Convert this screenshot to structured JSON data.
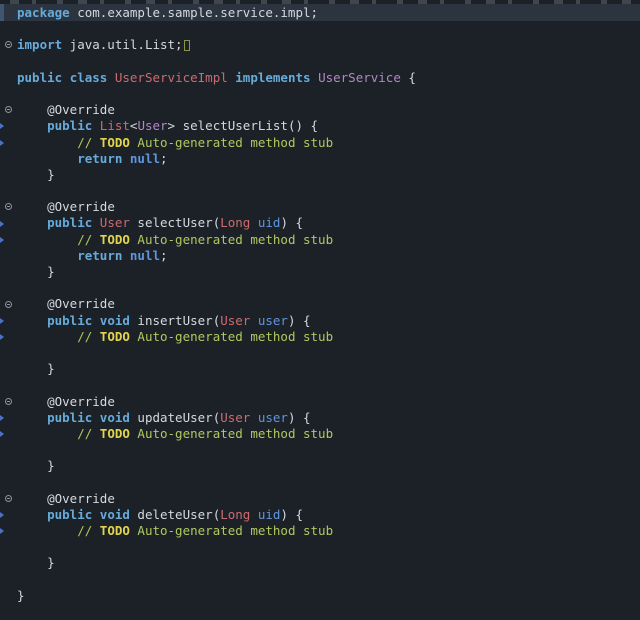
{
  "editor": {
    "background": "#1c2128",
    "current_line_bg": "#2c3440",
    "current_line_bar": "#3e566f",
    "colors": {
      "keyword": "#66abd9",
      "plain": "#d4d9de",
      "class_type": "#cc6b6f",
      "interface_type": "#b288c6",
      "comment": "#aec95e",
      "task_tag": "#e0d54e",
      "param_value": "#5f95dd"
    },
    "gutter": {
      "fold_icon_lines": [
        3,
        7,
        13,
        19,
        25,
        31
      ],
      "edge_marker_lines": [
        8,
        9,
        14,
        15,
        20,
        21,
        26,
        27,
        32,
        33
      ]
    },
    "code": {
      "lines": [
        {
          "n": 1,
          "highlight": true,
          "tokens": [
            {
              "c": "kw",
              "t": "package"
            },
            {
              "c": "pl",
              "t": " com.example.sample.service.impl;"
            }
          ]
        },
        {
          "n": 2,
          "tokens": []
        },
        {
          "n": 3,
          "tokens": [
            {
              "c": "kw",
              "t": "import"
            },
            {
              "c": "pl",
              "t": " java.util.List;"
            },
            {
              "c": "box",
              "t": ""
            }
          ]
        },
        {
          "n": 4,
          "tokens": []
        },
        {
          "n": 5,
          "tokens": [
            {
              "c": "kw",
              "t": "public"
            },
            {
              "c": "pl",
              "t": " "
            },
            {
              "c": "kw",
              "t": "class"
            },
            {
              "c": "pl",
              "t": " "
            },
            {
              "c": "cls",
              "t": "UserServiceImpl"
            },
            {
              "c": "pl",
              "t": " "
            },
            {
              "c": "kw",
              "t": "implements"
            },
            {
              "c": "pl",
              "t": " "
            },
            {
              "c": "itf",
              "t": "UserService"
            },
            {
              "c": "pl",
              "t": " {"
            }
          ]
        },
        {
          "n": 6,
          "tokens": []
        },
        {
          "n": 7,
          "tokens": [
            {
              "c": "pl",
              "t": "    "
            },
            {
              "c": "ann",
              "t": "@Override"
            }
          ]
        },
        {
          "n": 8,
          "tokens": [
            {
              "c": "pl",
              "t": "    "
            },
            {
              "c": "kw",
              "t": "public"
            },
            {
              "c": "pl",
              "t": " "
            },
            {
              "c": "cls",
              "t": "List"
            },
            {
              "c": "pl",
              "t": "<"
            },
            {
              "c": "itf",
              "t": "User"
            },
            {
              "c": "pl",
              "t": "> selectUserList() {"
            }
          ]
        },
        {
          "n": 9,
          "tokens": [
            {
              "c": "cmt",
              "t": "        // "
            },
            {
              "c": "todo",
              "t": "TODO"
            },
            {
              "c": "cmt",
              "t": " Auto-generated method stub"
            }
          ]
        },
        {
          "n": 10,
          "tokens": [
            {
              "c": "pl",
              "t": "        "
            },
            {
              "c": "kw",
              "t": "return"
            },
            {
              "c": "pl",
              "t": " "
            },
            {
              "c": "nul",
              "t": "null"
            },
            {
              "c": "pl",
              "t": ";"
            }
          ]
        },
        {
          "n": 11,
          "tokens": [
            {
              "c": "pl",
              "t": "    }"
            }
          ]
        },
        {
          "n": 12,
          "tokens": []
        },
        {
          "n": 13,
          "tokens": [
            {
              "c": "pl",
              "t": "    "
            },
            {
              "c": "ann",
              "t": "@Override"
            }
          ]
        },
        {
          "n": 14,
          "tokens": [
            {
              "c": "pl",
              "t": "    "
            },
            {
              "c": "kw",
              "t": "public"
            },
            {
              "c": "pl",
              "t": " "
            },
            {
              "c": "cls",
              "t": "User"
            },
            {
              "c": "pl",
              "t": " selectUser("
            },
            {
              "c": "cls",
              "t": "Long"
            },
            {
              "c": "pl",
              "t": " "
            },
            {
              "c": "prm",
              "t": "uid"
            },
            {
              "c": "pl",
              "t": ") {"
            }
          ]
        },
        {
          "n": 15,
          "tokens": [
            {
              "c": "cmt",
              "t": "        // "
            },
            {
              "c": "todo",
              "t": "TODO"
            },
            {
              "c": "cmt",
              "t": " Auto-generated method stub"
            }
          ]
        },
        {
          "n": 16,
          "tokens": [
            {
              "c": "pl",
              "t": "        "
            },
            {
              "c": "kw",
              "t": "return"
            },
            {
              "c": "pl",
              "t": " "
            },
            {
              "c": "nul",
              "t": "null"
            },
            {
              "c": "pl",
              "t": ";"
            }
          ]
        },
        {
          "n": 17,
          "tokens": [
            {
              "c": "pl",
              "t": "    }"
            }
          ]
        },
        {
          "n": 18,
          "tokens": []
        },
        {
          "n": 19,
          "tokens": [
            {
              "c": "pl",
              "t": "    "
            },
            {
              "c": "ann",
              "t": "@Override"
            }
          ]
        },
        {
          "n": 20,
          "tokens": [
            {
              "c": "pl",
              "t": "    "
            },
            {
              "c": "kw",
              "t": "public"
            },
            {
              "c": "pl",
              "t": " "
            },
            {
              "c": "kw",
              "t": "void"
            },
            {
              "c": "pl",
              "t": " insertUser("
            },
            {
              "c": "cls",
              "t": "User"
            },
            {
              "c": "pl",
              "t": " "
            },
            {
              "c": "prm",
              "t": "user"
            },
            {
              "c": "pl",
              "t": ") {"
            }
          ]
        },
        {
          "n": 21,
          "tokens": [
            {
              "c": "cmt",
              "t": "        // "
            },
            {
              "c": "todo",
              "t": "TODO"
            },
            {
              "c": "cmt",
              "t": " Auto-generated method stub"
            }
          ]
        },
        {
          "n": 22,
          "tokens": []
        },
        {
          "n": 23,
          "tokens": [
            {
              "c": "pl",
              "t": "    }"
            }
          ]
        },
        {
          "n": 24,
          "tokens": []
        },
        {
          "n": 25,
          "tokens": [
            {
              "c": "pl",
              "t": "    "
            },
            {
              "c": "ann",
              "t": "@Override"
            }
          ]
        },
        {
          "n": 26,
          "tokens": [
            {
              "c": "pl",
              "t": "    "
            },
            {
              "c": "kw",
              "t": "public"
            },
            {
              "c": "pl",
              "t": " "
            },
            {
              "c": "kw",
              "t": "void"
            },
            {
              "c": "pl",
              "t": " updateUser("
            },
            {
              "c": "cls",
              "t": "User"
            },
            {
              "c": "pl",
              "t": " "
            },
            {
              "c": "prm",
              "t": "user"
            },
            {
              "c": "pl",
              "t": ") {"
            }
          ]
        },
        {
          "n": 27,
          "tokens": [
            {
              "c": "cmt",
              "t": "        // "
            },
            {
              "c": "todo",
              "t": "TODO"
            },
            {
              "c": "cmt",
              "t": " Auto-generated method stub"
            }
          ]
        },
        {
          "n": 28,
          "tokens": []
        },
        {
          "n": 29,
          "tokens": [
            {
              "c": "pl",
              "t": "    }"
            }
          ]
        },
        {
          "n": 30,
          "tokens": []
        },
        {
          "n": 31,
          "tokens": [
            {
              "c": "pl",
              "t": "    "
            },
            {
              "c": "ann",
              "t": "@Override"
            }
          ]
        },
        {
          "n": 32,
          "tokens": [
            {
              "c": "pl",
              "t": "    "
            },
            {
              "c": "kw",
              "t": "public"
            },
            {
              "c": "pl",
              "t": " "
            },
            {
              "c": "kw",
              "t": "void"
            },
            {
              "c": "pl",
              "t": " deleteUser("
            },
            {
              "c": "cls",
              "t": "Long"
            },
            {
              "c": "pl",
              "t": " "
            },
            {
              "c": "prm",
              "t": "uid"
            },
            {
              "c": "pl",
              "t": ") {"
            }
          ]
        },
        {
          "n": 33,
          "tokens": [
            {
              "c": "cmt",
              "t": "        // "
            },
            {
              "c": "todo",
              "t": "TODO"
            },
            {
              "c": "cmt",
              "t": " Auto-generated method stub"
            }
          ]
        },
        {
          "n": 34,
          "tokens": []
        },
        {
          "n": 35,
          "tokens": [
            {
              "c": "pl",
              "t": "    }"
            }
          ]
        },
        {
          "n": 36,
          "tokens": []
        },
        {
          "n": 37,
          "tokens": [
            {
              "c": "pl",
              "t": "}"
            }
          ]
        }
      ]
    }
  }
}
